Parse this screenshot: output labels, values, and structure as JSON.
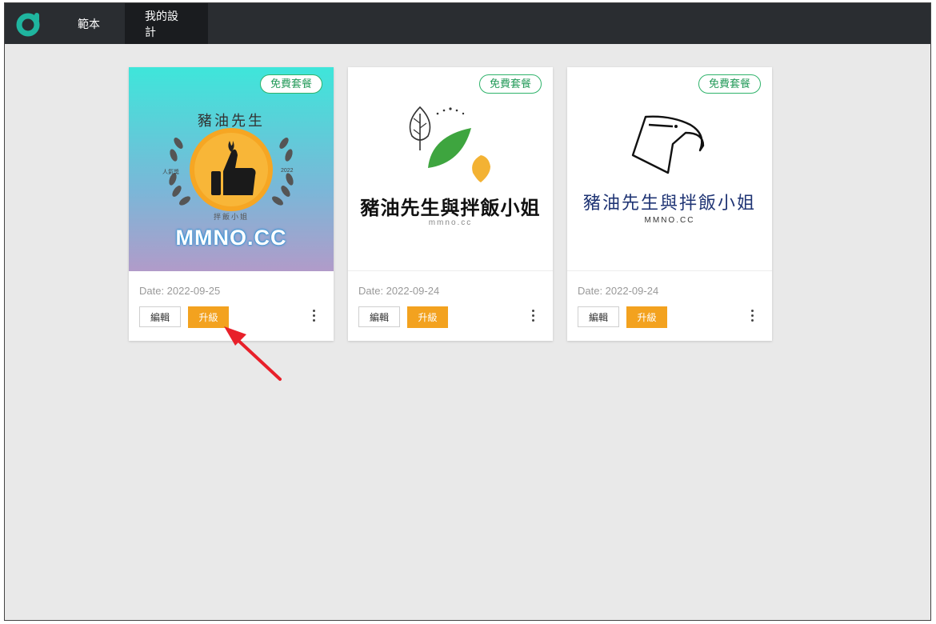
{
  "topbar": {
    "tabs": [
      {
        "label": "範本",
        "active": false
      },
      {
        "label": "我的設計",
        "active": true
      }
    ],
    "logo_color": "#1fb59f"
  },
  "cards": [
    {
      "badge": "免費套餐",
      "date": "Date: 2022-09-25",
      "edit_label": "編輯",
      "upgrade_label": "升級",
      "art": {
        "arc_text": "豬油先生",
        "left_text": "人氣獎",
        "right_text": "2022",
        "bottom_text": "拌飯小姐",
        "brand": "MMNO.CC"
      }
    },
    {
      "badge": "免費套餐",
      "date": "Date: 2022-09-24",
      "edit_label": "編輯",
      "upgrade_label": "升級",
      "art": {
        "title": "豬油先生與拌飯小姐",
        "subtitle": "mmno.cc"
      }
    },
    {
      "badge": "免費套餐",
      "date": "Date: 2022-09-24",
      "edit_label": "編輯",
      "upgrade_label": "升級",
      "art": {
        "title": "豬油先生與拌飯小姐",
        "subtitle": "MMNO.CC"
      }
    }
  ],
  "colors": {
    "badge_green": "#239a59",
    "upgrade_orange": "#f3a21f",
    "arrow_red": "#e8202a"
  }
}
